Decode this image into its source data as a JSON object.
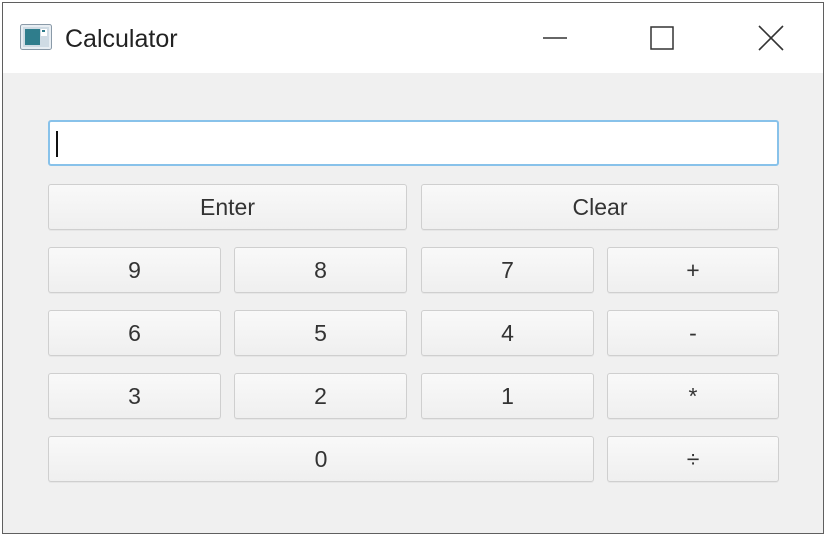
{
  "window": {
    "title": "Calculator",
    "icon": "calculator-app-icon",
    "controls": [
      "minimize-icon",
      "maximize-icon",
      "close-icon"
    ]
  },
  "display": {
    "value": "",
    "placeholder": ""
  },
  "buttons": {
    "enter": "Enter",
    "clear": "Clear",
    "nine": "9",
    "eight": "8",
    "seven": "7",
    "plus": "+",
    "six": "6",
    "five": "5",
    "four": "4",
    "minus": "-",
    "three": "3",
    "two": "2",
    "one": "1",
    "multiply": "*",
    "zero": "0",
    "divide": "÷"
  },
  "colors": {
    "window_bg": "#f0f0f0",
    "titlebar_bg": "#ffffff",
    "focus_border": "#88c2ea"
  }
}
